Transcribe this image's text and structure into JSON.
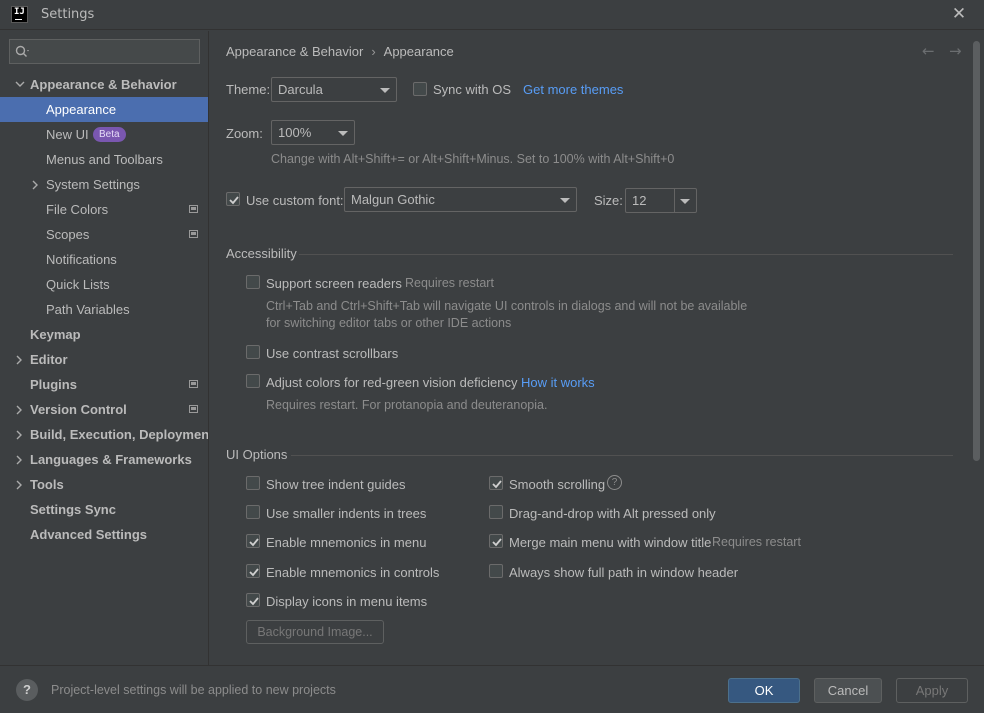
{
  "window": {
    "title": "Settings",
    "app_icon_text": "IJ"
  },
  "sidebar": {
    "search_placeholder": "",
    "items": [
      {
        "label": "Appearance & Behavior",
        "level": 0,
        "expanded": true,
        "selected": false
      },
      {
        "label": "Appearance",
        "level": 1,
        "selected": true
      },
      {
        "label": "New UI",
        "level": 1,
        "badge": "Beta"
      },
      {
        "label": "Menus and Toolbars",
        "level": 1
      },
      {
        "label": "System Settings",
        "level": 1,
        "expandable": true
      },
      {
        "label": "File Colors",
        "level": 1,
        "project_icon": true
      },
      {
        "label": "Scopes",
        "level": 1,
        "project_icon": true
      },
      {
        "label": "Notifications",
        "level": 1
      },
      {
        "label": "Quick Lists",
        "level": 1
      },
      {
        "label": "Path Variables",
        "level": 1
      },
      {
        "label": "Keymap",
        "level": 0
      },
      {
        "label": "Editor",
        "level": 0,
        "expandable": true
      },
      {
        "label": "Plugins",
        "level": 0,
        "project_icon": true
      },
      {
        "label": "Version Control",
        "level": 0,
        "expandable": true,
        "project_icon": true
      },
      {
        "label": "Build, Execution, Deployment",
        "level": 0,
        "expandable": true
      },
      {
        "label": "Languages & Frameworks",
        "level": 0,
        "expandable": true
      },
      {
        "label": "Tools",
        "level": 0,
        "expandable": true
      },
      {
        "label": "Settings Sync",
        "level": 0
      },
      {
        "label": "Advanced Settings",
        "level": 0
      }
    ]
  },
  "breadcrumb": {
    "parent": "Appearance & Behavior",
    "separator": "›",
    "current": "Appearance",
    "back": "←",
    "forward": "→"
  },
  "theme": {
    "label": "Theme:",
    "value": "Darcula",
    "sync_label": "Sync with OS",
    "sync_checked": false,
    "more_link": "Get more themes"
  },
  "zoom": {
    "label": "Zoom:",
    "value": "100%",
    "hint": "Change with Alt+Shift+= or Alt+Shift+Minus. Set to 100% with Alt+Shift+0"
  },
  "font": {
    "custom_label": "Use custom font:",
    "custom_checked": true,
    "font_value": "Malgun Gothic",
    "size_label": "Size:",
    "size_value": "12"
  },
  "accessibility": {
    "section": "Accessibility",
    "screen_readers_label": "Support screen readers",
    "screen_readers_note": "Requires restart",
    "screen_readers_desc_1": "Ctrl+Tab and Ctrl+Shift+Tab will navigate UI controls in dialogs and will not be available",
    "screen_readers_desc_2": "for switching editor tabs or other IDE actions",
    "contrast_label": "Use contrast scrollbars",
    "red_green_label": "Adjust colors for red-green vision deficiency",
    "how_it_works": "How it works",
    "red_green_desc": "Requires restart. For protanopia and deuteranopia."
  },
  "ui_options": {
    "section": "UI Options",
    "left": [
      {
        "label": "Show tree indent guides",
        "checked": false
      },
      {
        "label": "Use smaller indents in trees",
        "checked": false
      },
      {
        "label": "Enable mnemonics in menu",
        "checked": true
      },
      {
        "label": "Enable mnemonics in controls",
        "checked": true
      },
      {
        "label": "Display icons in menu items",
        "checked": true
      }
    ],
    "right": [
      {
        "label": "Smooth scrolling",
        "checked": true
      },
      {
        "label": "Drag-and-drop with Alt pressed only",
        "checked": false
      },
      {
        "label": "Merge main menu with window title",
        "checked": true,
        "note": "Requires restart"
      },
      {
        "label": "Always show full path in window header",
        "checked": false
      }
    ],
    "help_glyph": "?",
    "background_button": "Background Image..."
  },
  "footer": {
    "help_glyph": "?",
    "note": "Project-level settings will be applied to new projects",
    "ok": "OK",
    "cancel": "Cancel",
    "apply": "Apply"
  },
  "colors": {
    "background": "#3c3f41",
    "selection": "#4b6eaf",
    "link": "#589df6",
    "primary_button": "#365880",
    "badge": "#7a57b0"
  },
  "icons": [
    "search-icon",
    "chevron-down-icon",
    "chevron-right-icon",
    "close-icon",
    "project-level-icon",
    "checkmark-icon",
    "help-icon",
    "back-arrow-icon",
    "forward-arrow-icon"
  ]
}
